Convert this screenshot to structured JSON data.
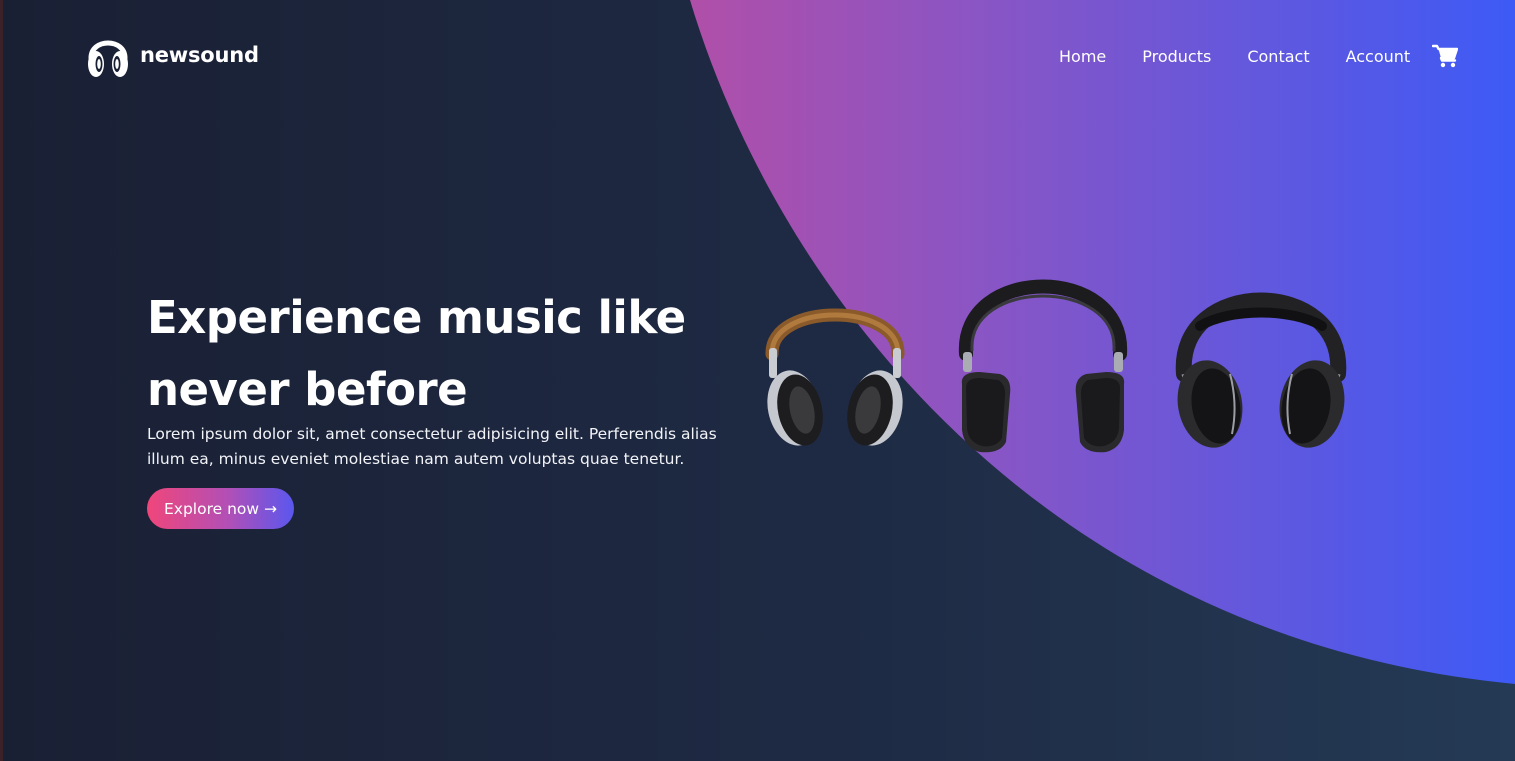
{
  "brand": {
    "name": "newsound",
    "icon": "headphones-icon"
  },
  "nav": {
    "items": [
      {
        "label": "Home"
      },
      {
        "label": "Products"
      },
      {
        "label": "Contact"
      },
      {
        "label": "Account"
      }
    ],
    "cart_icon": "cart-icon"
  },
  "hero": {
    "title": "Experience music like never before",
    "description": "Lorem ipsum dolor sit, amet consectetur adipisicing elit. Perferendis alias illum ea, minus eveniet molestiae nam autem voluptas quae tenetur.",
    "cta_label": "Explore now →"
  },
  "products": [
    {
      "name": "brown-silver-headphones"
    },
    {
      "name": "black-studio-headphones"
    },
    {
      "name": "black-wireless-headphones"
    }
  ],
  "colors": {
    "background_dark": "#1a2034",
    "background_mid": "#243a55",
    "accent_pink": "#f0467a",
    "accent_magenta": "#a94fb2",
    "accent_blue": "#3d5af1"
  }
}
